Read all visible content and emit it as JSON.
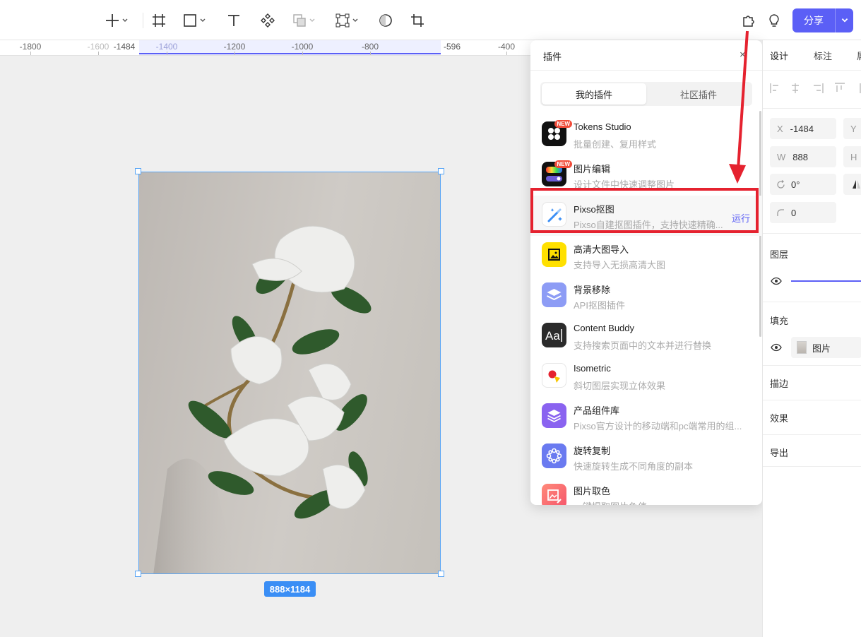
{
  "toolbar": {
    "tools": [
      "add-icon",
      "frame-icon",
      "rectangle-icon",
      "text-icon",
      "component-icon",
      "boolean-icon",
      "vector-icon",
      "ellipse-icon",
      "crop-icon"
    ],
    "share_label": "分享"
  },
  "ruler": {
    "labels": [
      "-1800",
      "-1600",
      "-1484",
      "-1400",
      "-1200",
      "-1000",
      "-800",
      "-596",
      "-400"
    ]
  },
  "canvas": {
    "size_badge": "888×1184"
  },
  "plugin_panel": {
    "title": "插件",
    "close": "×",
    "tabs": [
      "我的插件",
      "社区插件"
    ],
    "run_label": "运行",
    "new_badge": "NEW",
    "items": [
      {
        "name": "Tokens Studio",
        "desc": "批量创建、复用样式"
      },
      {
        "name": "图片编辑",
        "desc": "设计文件中快速调整图片"
      },
      {
        "name": "Pixso抠图",
        "desc": "Pixso自建抠图插件，支持快速精确..."
      },
      {
        "name": "高清大图导入",
        "desc": "支持导入无损高清大图"
      },
      {
        "name": "背景移除",
        "desc": "API抠图插件"
      },
      {
        "name": "Content Buddy",
        "desc": "支持搜索页面中的文本并进行替换"
      },
      {
        "name": "Isometric",
        "desc": "斜切图层实现立体效果"
      },
      {
        "name": "产品组件库",
        "desc": "Pixso官方设计的移动端和pc端常用的组..."
      },
      {
        "name": "旋转复制",
        "desc": "快速旋转生成不同角度的副本"
      },
      {
        "name": "图片取色",
        "desc": "一键提取图片色值"
      }
    ]
  },
  "design_panel": {
    "tabs": [
      "设计",
      "标注",
      "属"
    ],
    "x_label": "X",
    "x_value": "-1484",
    "y_label": "Y",
    "w_label": "W",
    "w_value": "888",
    "h_label": "H",
    "rotation": "0°",
    "radius": "0",
    "layer_label": "图层",
    "fill_label": "填充",
    "fill_value": "图片",
    "stroke_label": "描边",
    "effect_label": "效果",
    "export_label": "导出"
  },
  "colors": {
    "accent": "#5b5ff6",
    "highlight": "#e5222f",
    "selection": "#3a8ef5"
  }
}
